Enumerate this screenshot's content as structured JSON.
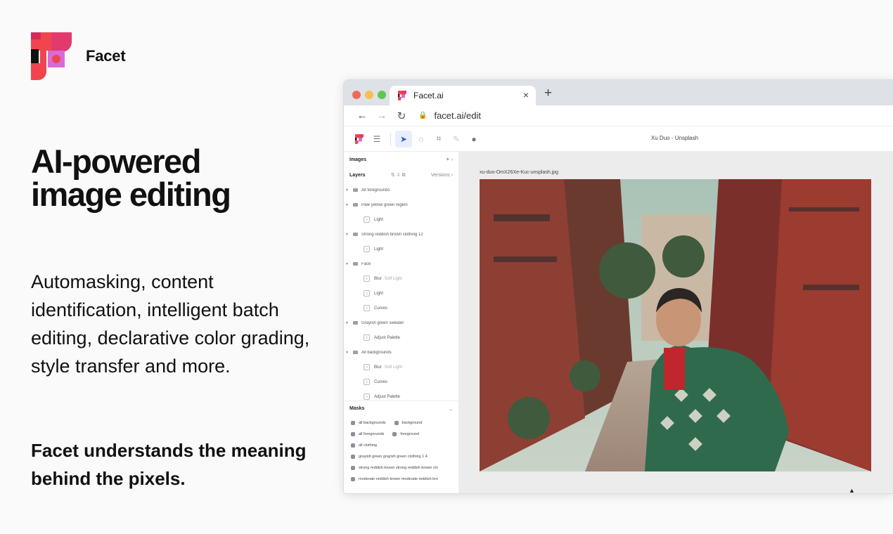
{
  "brand": {
    "name": "Facet"
  },
  "hero": {
    "headline_line1": "AI-powered",
    "headline_line2": "image editing",
    "body": "Automasking, content identification, intelligent batch editing, declarative color grading, style transfer and more.",
    "tagline": "Facet understands the meaning behind the pixels."
  },
  "browser": {
    "tab_title": "Facet.ai",
    "tab_close": "×",
    "new_tab": "+",
    "url": "facet.ai/edit",
    "traffic_colors": [
      "#ed6a5e",
      "#f5bf4f",
      "#61c554"
    ]
  },
  "toolbar": {
    "image_title": "Xu Duo - Unsplash",
    "icons": [
      "facet-logo-icon",
      "menu-icon",
      "pointer-icon",
      "lasso-icon",
      "crop-icon",
      "brush-icon",
      "comment-icon"
    ]
  },
  "sidebar": {
    "images_label": "Images",
    "layers_label": "Layers",
    "versions_label": "Versions ›",
    "layers": [
      {
        "label": "All foregrounds",
        "children": []
      },
      {
        "label": "Pale yellow green region",
        "children": [
          {
            "label": "Light",
            "mode": ""
          }
        ]
      },
      {
        "label": "Strong reddish brown clothing 12",
        "children": [
          {
            "label": "Light",
            "mode": ""
          }
        ]
      },
      {
        "label": "Face",
        "children": [
          {
            "label": "Blur",
            "mode": "Soft Light"
          },
          {
            "label": "Light",
            "mode": ""
          },
          {
            "label": "Curves",
            "mode": ""
          }
        ]
      },
      {
        "label": "Grayish green sweater",
        "children": [
          {
            "label": "Adjust Palette",
            "mode": ""
          }
        ]
      },
      {
        "label": "All backgrounds",
        "children": [
          {
            "label": "Blur",
            "mode": "Soft Light"
          },
          {
            "label": "Curves",
            "mode": ""
          },
          {
            "label": "Adjust Palette",
            "mode": ""
          }
        ]
      }
    ],
    "masks_label": "Masks",
    "masks": [
      [
        "all backgrounds",
        "background"
      ],
      [
        "all foregrounds",
        "foreground"
      ],
      [
        "all clothing"
      ],
      [
        "grayish green grayish green clothing 1 4"
      ],
      [
        "strong reddish brown strong reddish brown clo"
      ],
      [
        "moderate reddish brown moderate reddish bro"
      ]
    ]
  },
  "canvas": {
    "filename": "xu-duo-OmX26Xe-Kuc-unsplash.jpg"
  },
  "colors": {
    "accent": "#2a5bd7",
    "text": "#111111",
    "page_bg": "#fafafa"
  }
}
